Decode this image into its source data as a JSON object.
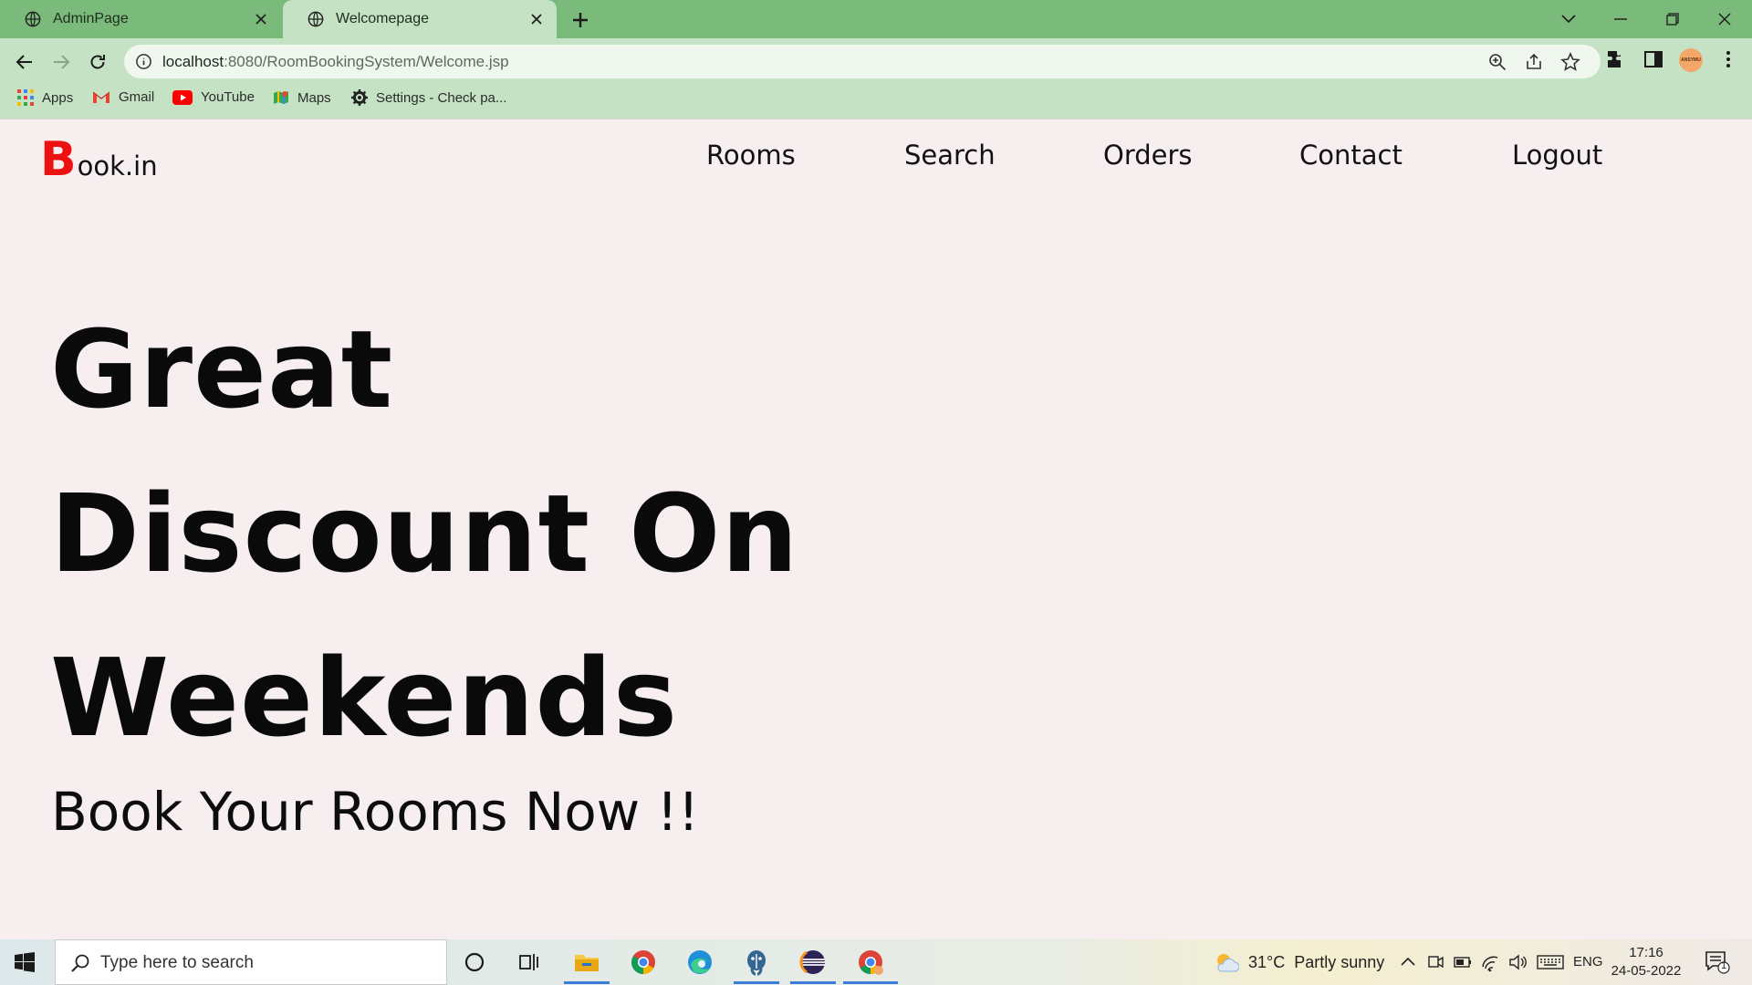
{
  "browser": {
    "tabs": [
      {
        "title": "AdminPage",
        "active": false
      },
      {
        "title": "Welcomepage",
        "active": true
      }
    ],
    "url": {
      "host": "localhost",
      "rest": ":8080/RoomBookingSystem/Welcome.jsp"
    },
    "bookmarks": [
      {
        "label": "Apps",
        "icon": "apps-grid-icon"
      },
      {
        "label": "Gmail",
        "icon": "gmail-icon"
      },
      {
        "label": "YouTube",
        "icon": "youtube-icon"
      },
      {
        "label": "Maps",
        "icon": "maps-icon"
      },
      {
        "label": "Settings - Check pa...",
        "icon": "gear-icon"
      }
    ],
    "profile_text": "ANSYMU",
    "colors": {
      "tabbar": "#7aba7a",
      "toolbar": "#c5e2c5"
    }
  },
  "site": {
    "logo_initial": "B",
    "logo_rest": "ook.in",
    "nav": [
      "Rooms",
      "Search",
      "Orders",
      "Contact",
      "Logout"
    ],
    "hero_lines": [
      "Great",
      "Discount On",
      "Weekends"
    ],
    "subheading": "Book Your Rooms Now !!",
    "colors": {
      "logo_accent": "#ee1111",
      "background": "#f7eeef"
    }
  },
  "taskbar": {
    "search_placeholder": "Type here to search",
    "weather": {
      "temp": "31°C",
      "condition": "Partly sunny"
    },
    "language": "ENG",
    "time": "17:16",
    "date": "24-05-2022",
    "notifications": "1"
  }
}
